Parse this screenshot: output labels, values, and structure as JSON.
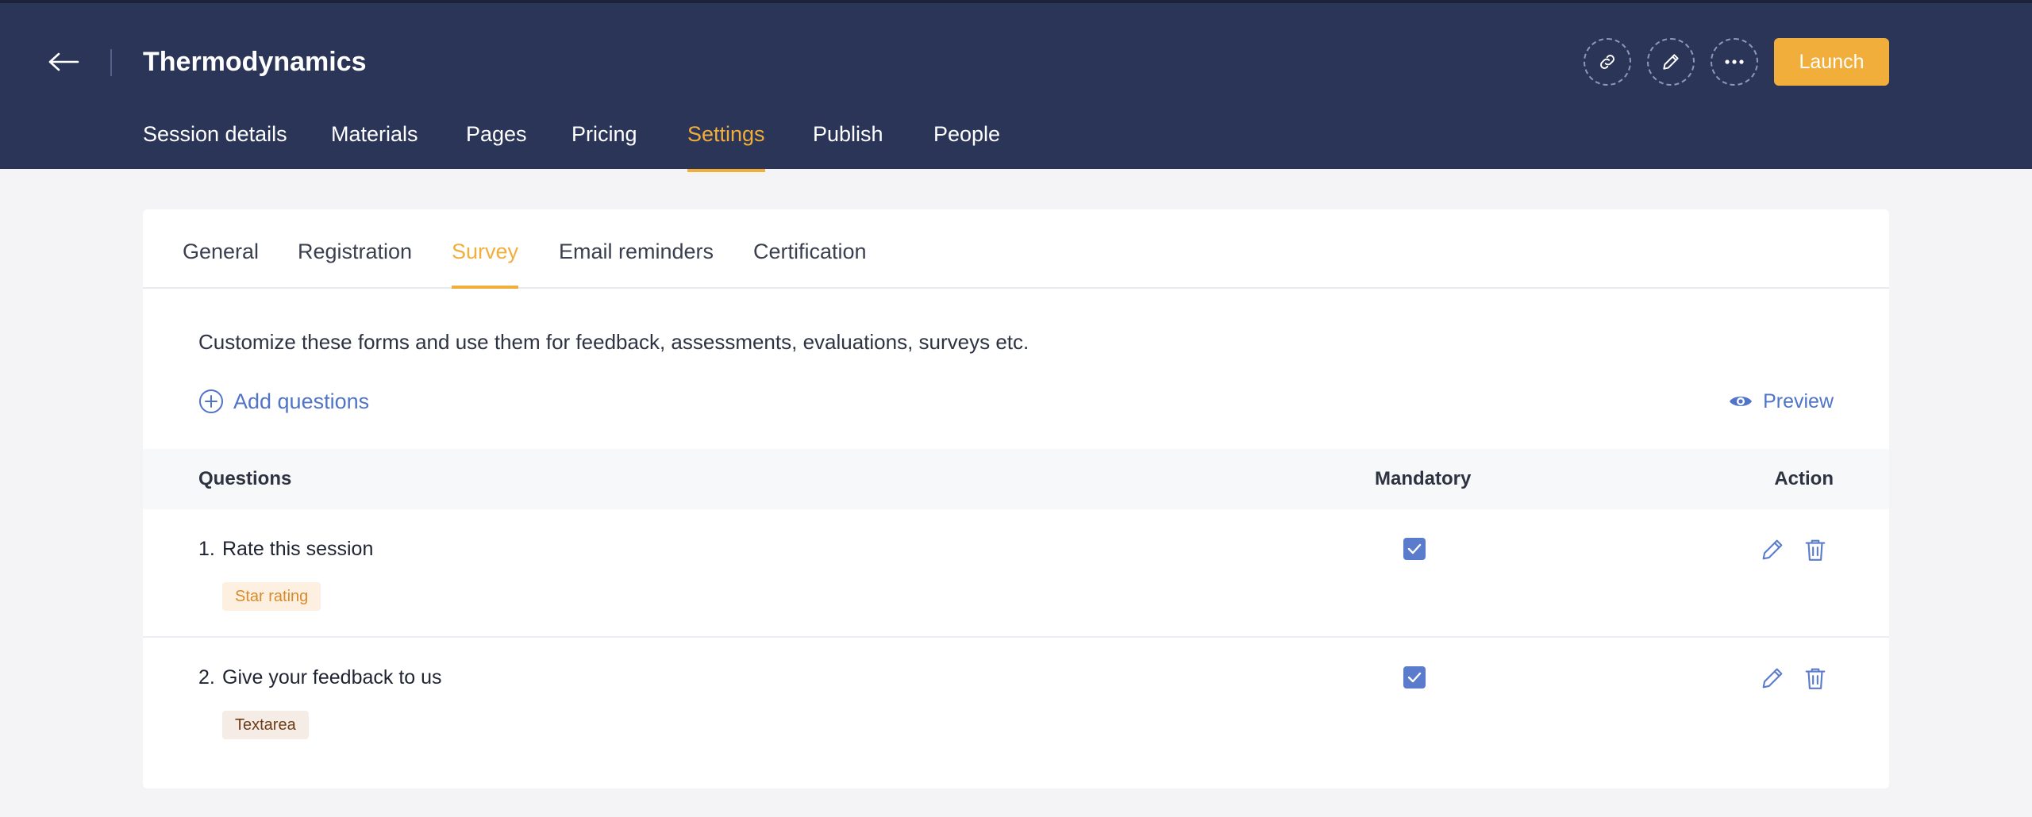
{
  "header": {
    "title": "Thermodynamics",
    "launch_label": "Launch",
    "icons": [
      "back-arrow-icon",
      "link-icon",
      "pencil-icon",
      "more-icon"
    ]
  },
  "main_tabs": [
    {
      "label": "Session details"
    },
    {
      "label": "Materials"
    },
    {
      "label": "Pages"
    },
    {
      "label": "Pricing"
    },
    {
      "label": "Settings",
      "active": true
    },
    {
      "label": "Publish"
    },
    {
      "label": "People"
    }
  ],
  "sub_tabs": [
    {
      "label": "General"
    },
    {
      "label": "Registration"
    },
    {
      "label": "Survey",
      "active": true
    },
    {
      "label": "Email reminders"
    },
    {
      "label": "Certification"
    }
  ],
  "survey": {
    "description": "Customize these forms and use them for feedback, assessments, evaluations, surveys etc.",
    "add_questions_label": "Add questions",
    "preview_label": "Preview",
    "columns": {
      "questions": "Questions",
      "mandatory": "Mandatory",
      "action": "Action"
    },
    "rows": [
      {
        "number": "1.",
        "question": "Rate this session",
        "type": "Star rating",
        "mandatory": true
      },
      {
        "number": "2.",
        "question": "Give your feedback to us",
        "type": "Textarea",
        "mandatory": true
      }
    ]
  },
  "colors": {
    "header_bg": "#2b3558",
    "accent": "#f2ae3a",
    "link": "#4f74c8",
    "checkbox": "#5b7ccc",
    "page_bg": "#f4f4f6"
  }
}
